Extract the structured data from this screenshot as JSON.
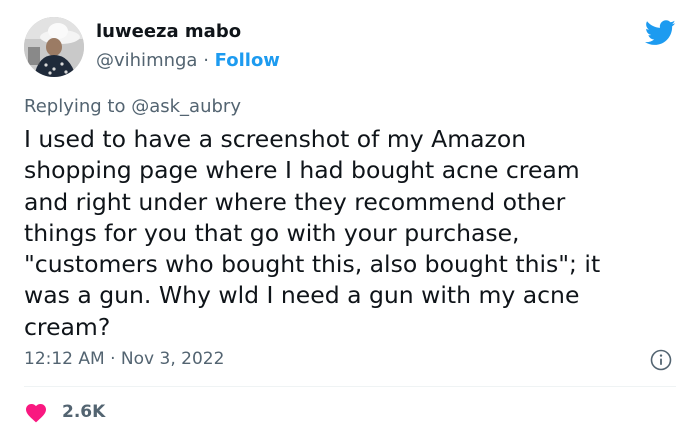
{
  "author": {
    "display_name": "luweeza mabo",
    "handle": "@vihimnga",
    "separator": "·",
    "follow_label": "Follow"
  },
  "reply": {
    "prefix": "Replying to",
    "mention": "@ask_aubry"
  },
  "tweet": {
    "lines": [
      "I used to have a screenshot of my Amazon",
      "shopping page where I had bought acne cream",
      "and right under where they recommend other",
      "things for you that go with your purchase,",
      "\"customers who bought this, also bought this\"; it",
      "was a gun. Why wld I need a gun with my acne",
      "cream?"
    ]
  },
  "meta": {
    "time": "12:12 AM",
    "separator": "·",
    "date": "Nov 3, 2022"
  },
  "engagement": {
    "likes": "2.6K"
  },
  "icons": {
    "brand": "twitter-bird-icon",
    "info": "info-icon",
    "like": "heart-icon"
  },
  "colors": {
    "accent": "#1d9bf0",
    "heart": "#f91880",
    "secondary_text": "#536471",
    "primary_text": "#0f1419"
  }
}
